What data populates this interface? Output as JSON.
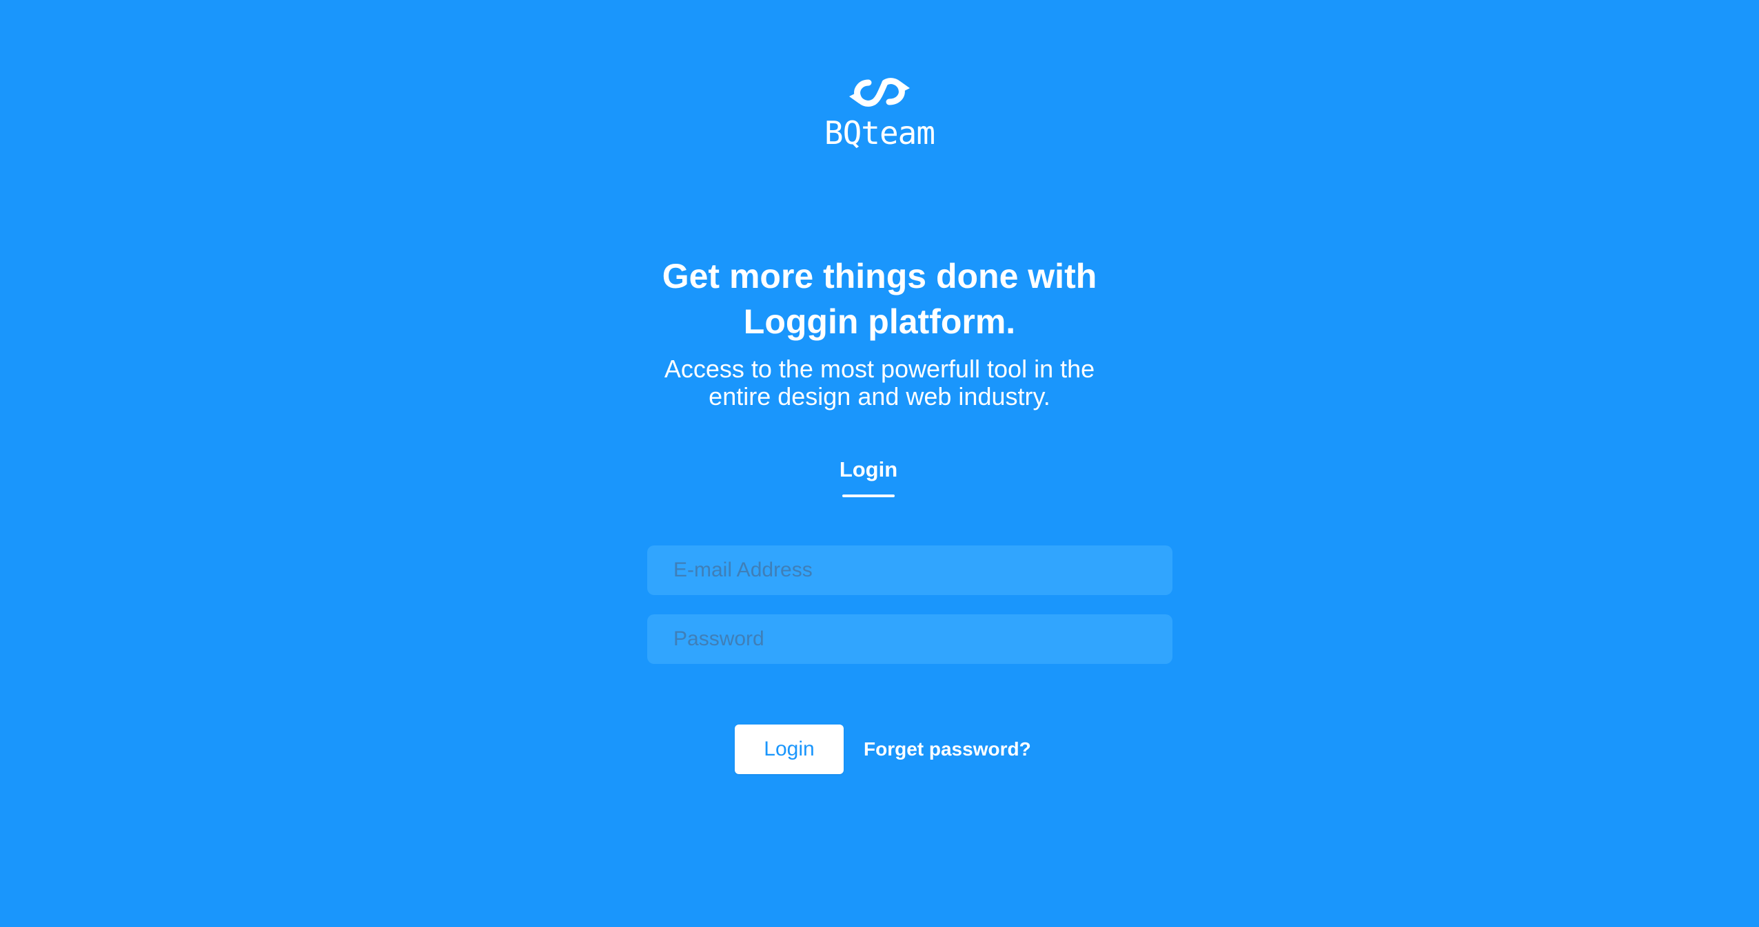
{
  "brand": {
    "name": "BQteam",
    "logo_icon": "sync-arrows-icon",
    "background_color": "#1a96fc"
  },
  "hero": {
    "headline_line1": "Get more things done with",
    "headline_line2": "Loggin platform.",
    "subtitle_line1": "Access to the most powerfull tool in the",
    "subtitle_line2": "entire design and web industry."
  },
  "tabs": [
    {
      "label": "Login",
      "active": true
    }
  ],
  "form": {
    "email": {
      "value": "",
      "placeholder": "E-mail Address"
    },
    "password": {
      "value": "",
      "placeholder": "Password"
    },
    "submit_label": "Login",
    "forgot_label": "Forget password?"
  }
}
